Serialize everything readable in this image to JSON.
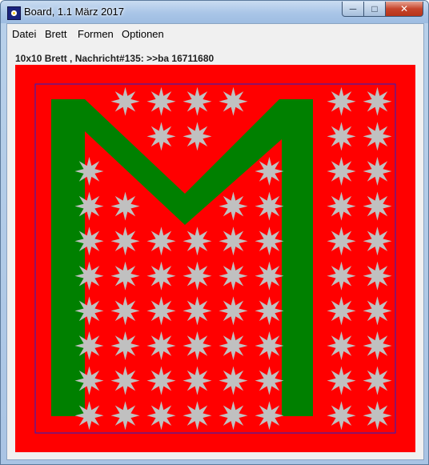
{
  "window": {
    "title": "Board, 1.1 März 2017",
    "controls": {
      "minimize": "─",
      "maximize": "□",
      "close": "✕"
    }
  },
  "menu": {
    "items": [
      {
        "label": "Datei"
      },
      {
        "label": "Brett"
      },
      {
        "label": "Formen"
      },
      {
        "label": "Optionen"
      }
    ]
  },
  "status": {
    "message": "10x10 Brett , Nachricht#135: >>ba 16711680"
  },
  "board": {
    "rows": 10,
    "cols": 10,
    "background_color": "#ff0000",
    "border_color": "#2222cc",
    "letter": "M",
    "letter_color": "#008000",
    "star_color": "#c0c0c0",
    "star_points": 8,
    "stars": [
      [
        0,
        2
      ],
      [
        0,
        3
      ],
      [
        0,
        4
      ],
      [
        0,
        5
      ],
      [
        0,
        8
      ],
      [
        0,
        9
      ],
      [
        1,
        3
      ],
      [
        1,
        4
      ],
      [
        1,
        8
      ],
      [
        1,
        9
      ],
      [
        2,
        1
      ],
      [
        2,
        6
      ],
      [
        2,
        8
      ],
      [
        2,
        9
      ],
      [
        3,
        1
      ],
      [
        3,
        2
      ],
      [
        3,
        5
      ],
      [
        3,
        6
      ],
      [
        3,
        8
      ],
      [
        3,
        9
      ],
      [
        4,
        1
      ],
      [
        4,
        2
      ],
      [
        4,
        3
      ],
      [
        4,
        4
      ],
      [
        4,
        5
      ],
      [
        4,
        6
      ],
      [
        4,
        8
      ],
      [
        4,
        9
      ],
      [
        5,
        1
      ],
      [
        5,
        2
      ],
      [
        5,
        3
      ],
      [
        5,
        4
      ],
      [
        5,
        5
      ],
      [
        5,
        6
      ],
      [
        5,
        8
      ],
      [
        5,
        9
      ],
      [
        6,
        1
      ],
      [
        6,
        2
      ],
      [
        6,
        3
      ],
      [
        6,
        4
      ],
      [
        6,
        5
      ],
      [
        6,
        6
      ],
      [
        6,
        8
      ],
      [
        6,
        9
      ],
      [
        7,
        1
      ],
      [
        7,
        2
      ],
      [
        7,
        3
      ],
      [
        7,
        4
      ],
      [
        7,
        5
      ],
      [
        7,
        6
      ],
      [
        7,
        8
      ],
      [
        7,
        9
      ],
      [
        8,
        1
      ],
      [
        8,
        2
      ],
      [
        8,
        3
      ],
      [
        8,
        4
      ],
      [
        8,
        5
      ],
      [
        8,
        6
      ],
      [
        8,
        8
      ],
      [
        8,
        9
      ],
      [
        9,
        1
      ],
      [
        9,
        2
      ],
      [
        9,
        3
      ],
      [
        9,
        4
      ],
      [
        9,
        5
      ],
      [
        9,
        6
      ],
      [
        9,
        8
      ],
      [
        9,
        9
      ]
    ]
  }
}
